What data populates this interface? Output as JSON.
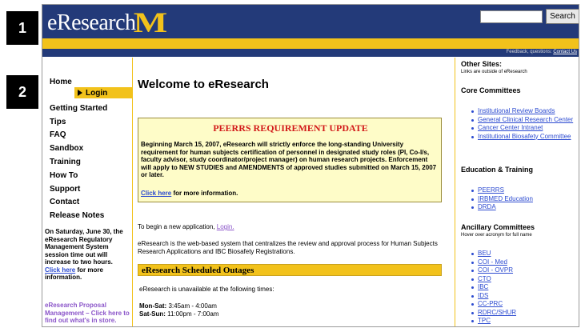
{
  "badges": {
    "first": "1",
    "second": "2"
  },
  "header": {
    "logo_text": "eResearch",
    "logo_mark": "M",
    "search_button": "Search",
    "search_value": "",
    "feedback_text": "Feedback, questions:",
    "contact_link": "Contact Us"
  },
  "nav": {
    "home": "Home",
    "login": "Login",
    "items": [
      "Getting Started",
      "Tips",
      "FAQ",
      "Sandbox",
      "Training",
      "How To",
      "Support",
      "Contact",
      "Release Notes"
    ],
    "note_text": "On Saturday, June 30, the eResearch Regulatory Management System session time out will increase to two hours.",
    "note_link": "Click here",
    "note_suffix": "for more information.",
    "proposal_text": "eResearch Proposal Management – Click here to find out what's in store."
  },
  "main": {
    "title": "Welcome to eResearch",
    "peerrs_title": "PEERRS REQUIREMENT UPDATE",
    "peerrs_body": "Beginning March 15, 2007, eResearch will strictly enforce the long-standing University requirement for human subjects certification of personnel in designated study roles (PI, Co-I/s, faculty advisor, study coordinator/project manager) on human research projects. Enforcement will apply to NEW STUDIES and AMENDMENTS of approved studies submitted on March 15, 2007 or later.",
    "peerrs_link": "Click here",
    "peerrs_more": "for more information.",
    "begin_text": "To begin a new application,",
    "begin_link": "Login.",
    "intro_text": "eResearch is the web-based system that centralizes the review and approval process for Human Subjects Research Applications and IBC Biosafety Registrations.",
    "outage_title": "eResearch Scheduled Outages",
    "outage_intro": "eResearch is unavailable at the following times:",
    "outage_weekday_label": "Mon-Sat:",
    "outage_weekday_time": "3:45am - 4:00am",
    "outage_weekend_label": "Sat-Sun:",
    "outage_weekend_time": "11:00pm - 7:00am"
  },
  "right": {
    "other_sites": "Other Sites:",
    "other_sites_note": "Links are outside of eResearch",
    "core_heading": "Core Committees",
    "core_items": [
      "Institutional Review Boards",
      "General Clinical Research Center",
      "Cancer Center Intranet",
      "Institutional Biosafety Committee"
    ],
    "edu_heading": "Education & Training",
    "edu_items": [
      "PEERRS",
      "IRBMED Education",
      "DRDA"
    ],
    "anc_heading": "Ancillary Committees",
    "anc_note": "Hover over acronym for full name",
    "anc_items": [
      "BEU",
      "COI - Med",
      "COI - OVPR",
      "CTO",
      "IBC",
      "IDS",
      "CC-PRC",
      "RDRC/SHUR",
      "TPC"
    ]
  },
  "colors": {
    "navy": "#233a79",
    "maize": "#f2c21b",
    "alert_red": "#d21a1a",
    "link_blue": "#2b4ad0",
    "visited_purple": "#8b55c9"
  }
}
